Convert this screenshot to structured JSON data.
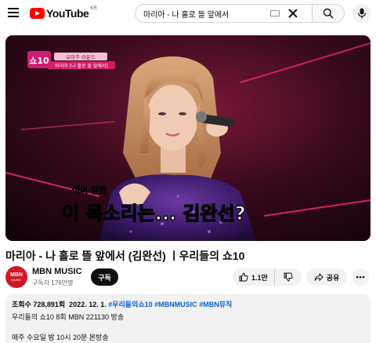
{
  "header": {
    "logo_text": "YouTube",
    "logo_region": "KR",
    "search_value": "마리아 - 나 홀로 뜰 앞에서"
  },
  "player": {
    "logo_text": "쇼10",
    "overlay_tag": "오마주 라운드",
    "overlay_song": "마리아 [나 홀로 뜰 앞에서]",
    "caption_small": "어머 잠깐",
    "caption_main": "이 목소리는... 김완선?"
  },
  "video": {
    "title": "마리아 - 나 홀로 뜰 앞에서 (김완선)  ㅣ우리들의 쇼10"
  },
  "channel": {
    "avatar_text": "MBN",
    "avatar_sub": "MUSIC",
    "name": "MBN MUSIC",
    "subscribers": "구독자 176만명",
    "subscribe_label": "구독"
  },
  "actions": {
    "like_count": "1.1만",
    "share_label": "공유"
  },
  "description": {
    "views": "조회수 728,891회",
    "date": "2022. 12. 1.",
    "tags": [
      "#우리들의쇼10",
      "#MBNMUSIC",
      "#MBN뮤직"
    ],
    "line1": "우리들의 쇼10 8회 MBN 221130 방송",
    "line2": "매주 수요일 밤 10시 20분 본방송"
  },
  "colors": {
    "brand_red": "#ff0000",
    "link_blue": "#065fd4",
    "stage_magenta": "#e0207a"
  }
}
